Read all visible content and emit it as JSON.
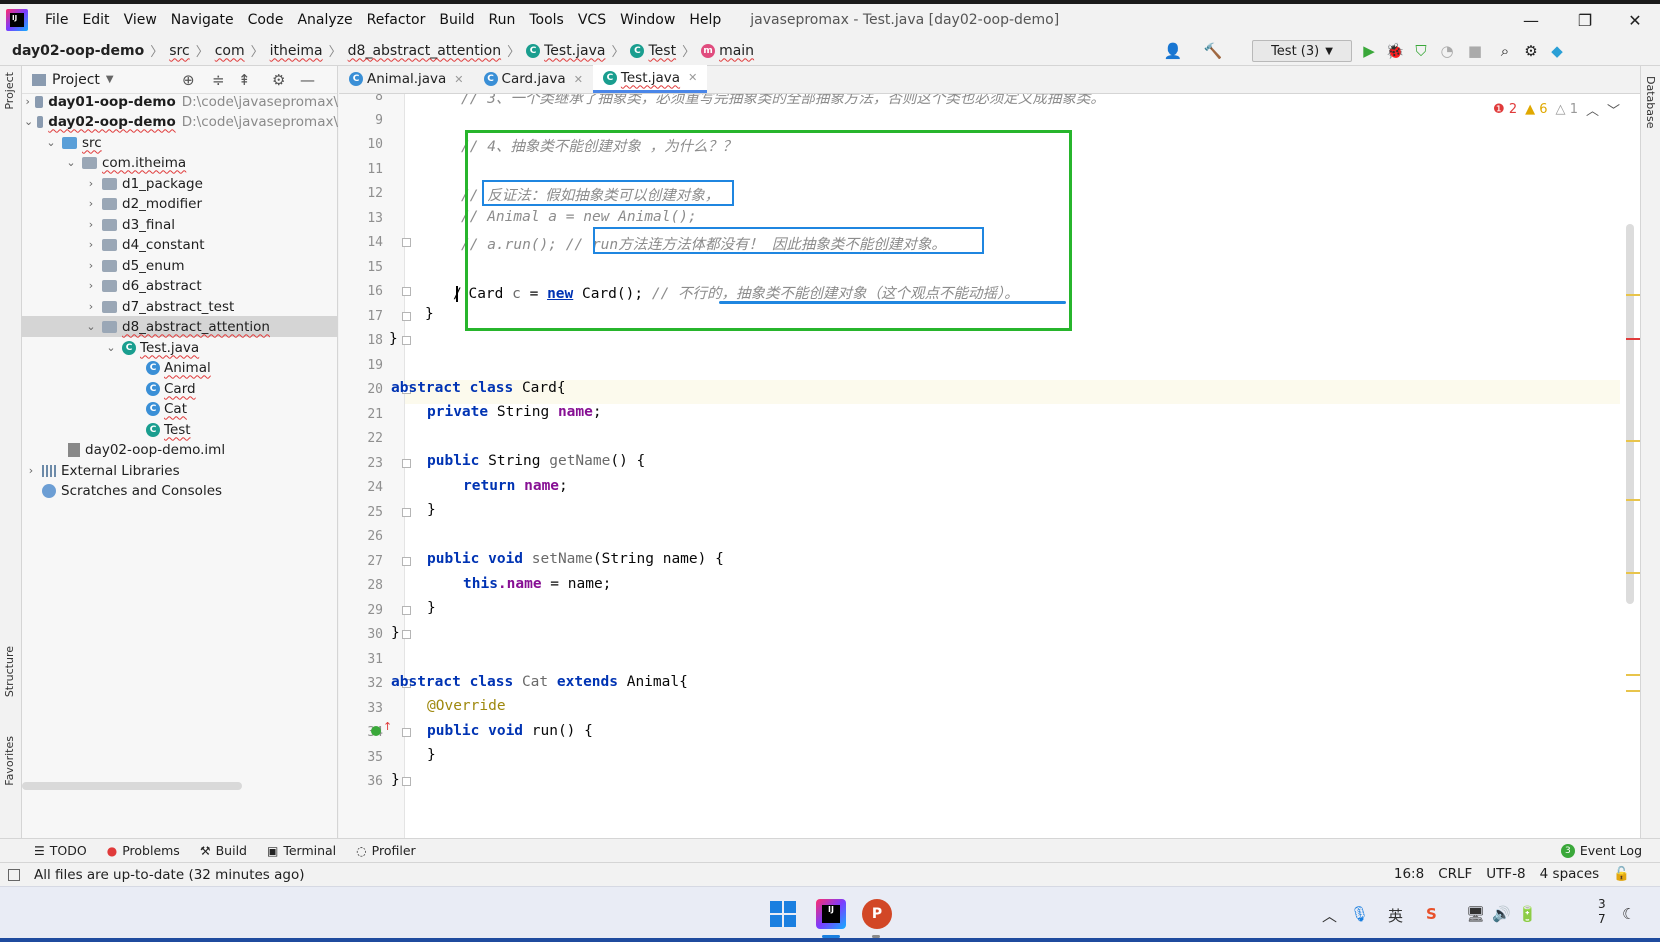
{
  "menu": {
    "items": [
      "File",
      "Edit",
      "View",
      "Navigate",
      "Code",
      "Analyze",
      "Refactor",
      "Build",
      "Run",
      "Tools",
      "VCS",
      "Window",
      "Help"
    ],
    "window_title": "javasepromax - Test.java [day02-oop-demo]"
  },
  "window_controls": {
    "minimize": "—",
    "restore": "❐",
    "close": "✕"
  },
  "breadcrumb": [
    "day02-oop-demo",
    "src",
    "com",
    "itheima",
    "d8_abstract_attention",
    "Test.java",
    "Test",
    "main"
  ],
  "run_config": {
    "label": "Test (3)"
  },
  "project_panel": {
    "title": "Project",
    "tree": [
      {
        "label": "day01-oop-demo",
        "path": "D:\\code\\javasepromax\\"
      },
      {
        "label": "day02-oop-demo",
        "path": "D:\\code\\javasepromax\\"
      },
      {
        "label": "src"
      },
      {
        "label": "com.itheima"
      },
      {
        "label": "d1_package"
      },
      {
        "label": "d2_modifier"
      },
      {
        "label": "d3_final"
      },
      {
        "label": "d4_constant"
      },
      {
        "label": "d5_enum"
      },
      {
        "label": "d6_abstract"
      },
      {
        "label": "d7_abstract_test"
      },
      {
        "label": "d8_abstract_attention"
      },
      {
        "label": "Test.java"
      },
      {
        "label": "Animal"
      },
      {
        "label": "Card"
      },
      {
        "label": "Cat"
      },
      {
        "label": "Test"
      },
      {
        "label": "day02-oop-demo.iml"
      },
      {
        "label": "External Libraries"
      },
      {
        "label": "Scratches and Consoles"
      }
    ]
  },
  "left_strip": {
    "project": "Project",
    "structure": "Structure",
    "favorites": "Favorites"
  },
  "right_strip": {
    "database": "Database"
  },
  "editor_tabs": [
    {
      "label": "Animal.java"
    },
    {
      "label": "Card.java"
    },
    {
      "label": "Test.java"
    }
  ],
  "inspections": {
    "errors": "2",
    "warnings": "6",
    "weak": "1"
  },
  "code": {
    "line_numbers": [
      "8",
      "9",
      "10",
      "11",
      "12",
      "13",
      "14",
      "15",
      "16",
      "17",
      "18",
      "19",
      "20",
      "21",
      "22",
      "23",
      "24",
      "25",
      "26",
      "27",
      "28",
      "29",
      "30",
      "31",
      "32",
      "33",
      "34",
      "35",
      "36"
    ],
    "l8": "// 3、一个类继承了抽象类，必须重写完抽象类的全部抽象方法，否则这个类也必须定义成抽象类。",
    "l10": "// 4、抽象类不能创建对象 ，为什么？？",
    "l12": "// 反证法：假如抽象类可以创建对象，",
    "l13": "// Animal a = new Animal();",
    "l14a": "// a.run(); ",
    "l14b": "// run方法连方法体都没有！ 因此抽象类不能创建对象。",
    "l16_slash": "/",
    "l16_card": "Card",
    "l16_c": "c",
    "l16_eq": " = ",
    "l16_new": "new",
    "l16_ctor": " Card();",
    "l16_cmt": "// 不行的，抽象类不能创建对象（这个观点不能动摇）。",
    "l17": "}",
    "l18": "}",
    "l20_kw": "abstract class",
    "l20_name": " Card{",
    "l21_kw": "private",
    "l21_type": " String ",
    "l21_field": "name",
    "l21_end": ";",
    "l23_kw": "public",
    "l23_type": " String ",
    "l23_meth": "getName",
    "l23_end": "() {",
    "l24_kw": "return",
    "l24_field": " name",
    "l24_end": ";",
    "l25": "}",
    "l27_kw": "public void",
    "l27_meth": " setName",
    "l27_end": "(String name) {",
    "l28_kw": "this",
    "l28_field": ".name",
    "l28_end": " = name;",
    "l29": "}",
    "l30": "}",
    "l32_kw": "abstract class",
    "l32_name": " Cat ",
    "l32_kw2": "extends",
    "l32_end": " Animal{",
    "l33": "@Override",
    "l34_kw": "public void",
    "l34_end": " run() {",
    "l35": "}",
    "l36": "}"
  },
  "bottom_tabs": [
    "TODO",
    "Problems",
    "Build",
    "Terminal",
    "Profiler"
  ],
  "event_log": {
    "label": "Event Log",
    "count": "3"
  },
  "status": {
    "message": "All files are up-to-date (32 minutes ago)",
    "position": "16:8",
    "line_sep": "CRLF",
    "encoding": "UTF-8",
    "indent": "4 spaces"
  },
  "taskbar": {
    "clock_top": "3",
    "clock_bottom": "7",
    "ime": "英"
  },
  "colors": {
    "keyword": "#0033b3",
    "comment": "#8c8c8c",
    "field": "#871094",
    "annotation_green": "#27b52c",
    "annotation_blue": "#1f86e0"
  }
}
